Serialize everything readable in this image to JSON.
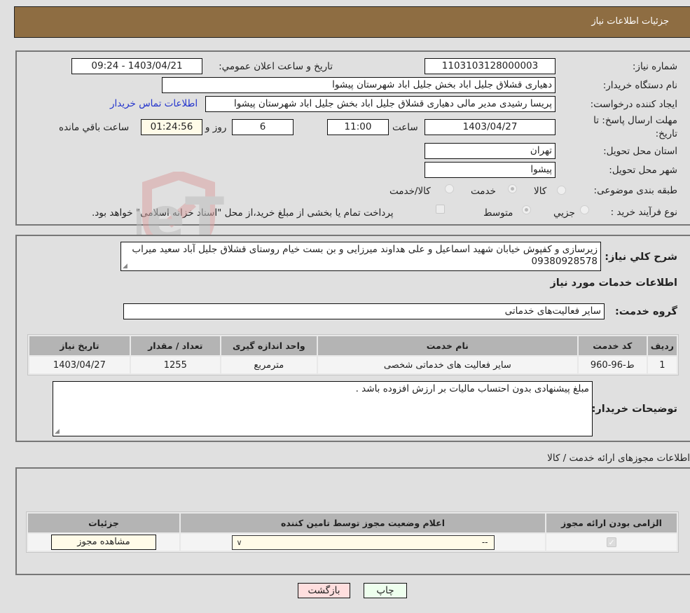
{
  "header": {
    "title": "جزئیات اطلاعات نیاز"
  },
  "details": {
    "need_number_label": "شماره نیاز:",
    "need_number": "1103103128000003",
    "announce_label": "تاریخ و ساعت اعلان عمومي:",
    "announce_value": "1403/04/21 - 09:24",
    "buyer_org_label": "نام دستگاه خریدار:",
    "buyer_org": "دهیاری قشلاق جلیل اباد بخش جلیل اباد شهرستان پیشوا",
    "creator_label": "ایجاد کننده درخواست:",
    "creator": "پریسا رشیدی مدیر مالی دهیاری قشلاق جلیل اباد بخش جلیل اباد شهرستان پیشوا",
    "contact_link": "اطلاعات تماس خریدار",
    "deadline_label_1": "مهلت ارسال پاسخ: تا",
    "deadline_label_2": "تاریخ:",
    "deadline_date": "1403/04/27",
    "time_label": "ساعت",
    "deadline_time": "11:00",
    "days": "6",
    "days_label": "روز و",
    "remaining_time": "01:24:56",
    "remaining_label": "ساعت باقي مانده",
    "province_label": "استان محل تحویل:",
    "province": "تهران",
    "city_label": "شهر محل تحویل:",
    "city": "پیشوا",
    "category_label": "طبقه بندی موضوعی:",
    "category_options": [
      {
        "label": "کالا",
        "selected": false
      },
      {
        "label": "خدمت",
        "selected": true
      },
      {
        "label": "کالا/خدمت",
        "selected": false
      }
    ],
    "process_label": "نوع فرآیند خرید :",
    "process_options": [
      {
        "label": "جزيي",
        "selected": false
      },
      {
        "label": "متوسط",
        "selected": true
      }
    ],
    "treasury_checkbox_label": "پرداخت تمام یا بخشی از مبلغ خرید،از محل \"اسناد خزانه اسلامی\" خواهد بود.",
    "treasury_checked": false
  },
  "services": {
    "summary_label": "شرح کلي نیاز:",
    "summary": "زیرسازی و کفپوش خیابان شهید اسماعیل و علی هداوند میرزایی و بن بست خیام روستای قشلاق جلیل آباد سعید میراب 09380928578",
    "section_title": "اطلاعات خدمات مورد نیاز",
    "group_label": "گروه خدمت:",
    "group_value": "سایر فعالیت‌های خدماتی",
    "table": {
      "headers": [
        "ردیف",
        "کد خدمت",
        "نام خدمت",
        "واحد اندازه گیری",
        "تعداد / مقدار",
        "تاریخ نیاز"
      ],
      "rows": [
        [
          "1",
          "ط-96-960",
          "سایر فعالیت های خدماتی شخصی",
          "مترمربع",
          "1255",
          "1403/04/27"
        ]
      ]
    },
    "buyer_notes_label": "توضیحات خریدار:",
    "buyer_notes": "مبلغ پیشنهادی بدون احتساب مالیات بر ارزش افزوده باشد ."
  },
  "permits": {
    "section_title": "اطلاعات مجوزهای ارائه خدمت / کالا",
    "headers": [
      "الزامی بودن ارائه مجوز",
      "اعلام وضعیت مجوز توسط تامین کننده",
      "جزئیات"
    ],
    "rows": [
      {
        "required": true,
        "status_selected": "--",
        "details_button": "مشاهده مجوز"
      }
    ]
  },
  "footer": {
    "print_label": "چاپ",
    "back_label": "بازگشت"
  },
  "watermark": {
    "text": "AriaTender.neT"
  }
}
